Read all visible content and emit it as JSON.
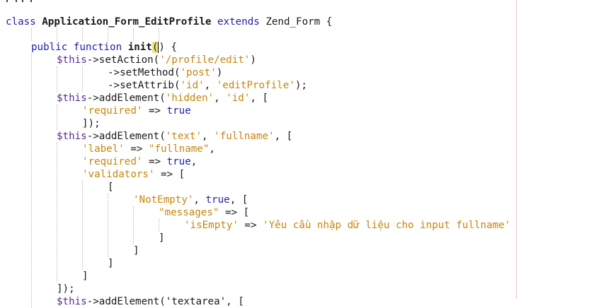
{
  "editor": {
    "language": "php",
    "colors": {
      "keyword": "#1f1fa8",
      "string": "#c6860e",
      "variable": "#5a2a92",
      "text": "#1a1a1a",
      "highlight": "#f3e37f",
      "margin": "#f3c4c4"
    },
    "lines": [
      {
        "indent": 0,
        "tokens": [
          [
            "kw",
            "class"
          ],
          [
            "plain",
            " "
          ],
          [
            "cls",
            "Application_Form_EditProfile"
          ],
          [
            "plain",
            " "
          ],
          [
            "kw",
            "extends"
          ],
          [
            "plain",
            " Zend_Form {"
          ]
        ]
      },
      {
        "indent": 0,
        "tokens": []
      },
      {
        "indent": 4,
        "tokens": [
          [
            "kw",
            "public"
          ],
          [
            "plain",
            " "
          ],
          [
            "kw",
            "function"
          ],
          [
            "plain",
            " "
          ],
          [
            "fn",
            "init"
          ],
          [
            "hl",
            "("
          ],
          [
            "cursor",
            ")"
          ],
          [
            "plain",
            " {"
          ]
        ]
      },
      {
        "indent": 8,
        "tokens": [
          [
            "var",
            "$this"
          ],
          [
            "plain",
            "->setAction("
          ],
          [
            "str",
            "'/profile/edit'"
          ],
          [
            "plain",
            ")"
          ]
        ]
      },
      {
        "indent": 16,
        "tokens": [
          [
            "plain",
            "->setMethod("
          ],
          [
            "str",
            "'post'"
          ],
          [
            "plain",
            ")"
          ]
        ]
      },
      {
        "indent": 16,
        "tokens": [
          [
            "plain",
            "->setAttrib("
          ],
          [
            "str",
            "'id'"
          ],
          [
            "plain",
            ", "
          ],
          [
            "str",
            "'editProfile'"
          ],
          [
            "plain",
            ");"
          ]
        ]
      },
      {
        "indent": 8,
        "tokens": [
          [
            "var",
            "$this"
          ],
          [
            "plain",
            "->addElement("
          ],
          [
            "str",
            "'hidden'"
          ],
          [
            "plain",
            ", "
          ],
          [
            "str",
            "'id'"
          ],
          [
            "plain",
            ", ["
          ]
        ]
      },
      {
        "indent": 12,
        "tokens": [
          [
            "str",
            "'required'"
          ],
          [
            "plain",
            " => "
          ],
          [
            "bool",
            "true"
          ]
        ]
      },
      {
        "indent": 12,
        "tokens": [
          [
            "plain",
            "]);"
          ]
        ]
      },
      {
        "indent": 8,
        "tokens": [
          [
            "var",
            "$this"
          ],
          [
            "plain",
            "->addElement("
          ],
          [
            "str",
            "'text'"
          ],
          [
            "plain",
            ", "
          ],
          [
            "str",
            "'fullname'"
          ],
          [
            "plain",
            ", ["
          ]
        ]
      },
      {
        "indent": 12,
        "tokens": [
          [
            "str",
            "'label'"
          ],
          [
            "plain",
            " => "
          ],
          [
            "str",
            "\"fullname\""
          ],
          [
            "plain",
            ","
          ]
        ]
      },
      {
        "indent": 12,
        "tokens": [
          [
            "str",
            "'required'"
          ],
          [
            "plain",
            " => "
          ],
          [
            "bool",
            "true"
          ],
          [
            "plain",
            ","
          ]
        ]
      },
      {
        "indent": 12,
        "tokens": [
          [
            "str",
            "'validators'"
          ],
          [
            "plain",
            " => ["
          ]
        ]
      },
      {
        "indent": 16,
        "tokens": [
          [
            "plain",
            "["
          ]
        ]
      },
      {
        "indent": 20,
        "tokens": [
          [
            "str",
            "'NotEmpty'"
          ],
          [
            "plain",
            ", "
          ],
          [
            "bool",
            "true"
          ],
          [
            "plain",
            ", ["
          ]
        ]
      },
      {
        "indent": 24,
        "tokens": [
          [
            "str",
            "\"messages\""
          ],
          [
            "plain",
            " => ["
          ]
        ]
      },
      {
        "indent": 28,
        "tokens": [
          [
            "str",
            "'isEmpty'"
          ],
          [
            "plain",
            " => "
          ],
          [
            "str",
            "'Yêu cầu nhập dữ liệu cho input fullname'"
          ]
        ]
      },
      {
        "indent": 24,
        "tokens": [
          [
            "plain",
            "]"
          ]
        ]
      },
      {
        "indent": 20,
        "tokens": [
          [
            "plain",
            "]"
          ]
        ]
      },
      {
        "indent": 16,
        "tokens": [
          [
            "plain",
            "]"
          ]
        ]
      },
      {
        "indent": 12,
        "tokens": [
          [
            "plain",
            "]"
          ]
        ]
      },
      {
        "indent": 8,
        "tokens": [
          [
            "plain",
            "]);"
          ]
        ]
      },
      {
        "indent": 8,
        "tokens": [
          [
            "var",
            "$this"
          ],
          [
            "plain",
            "->addElement('textarea', ["
          ]
        ]
      }
    ]
  }
}
